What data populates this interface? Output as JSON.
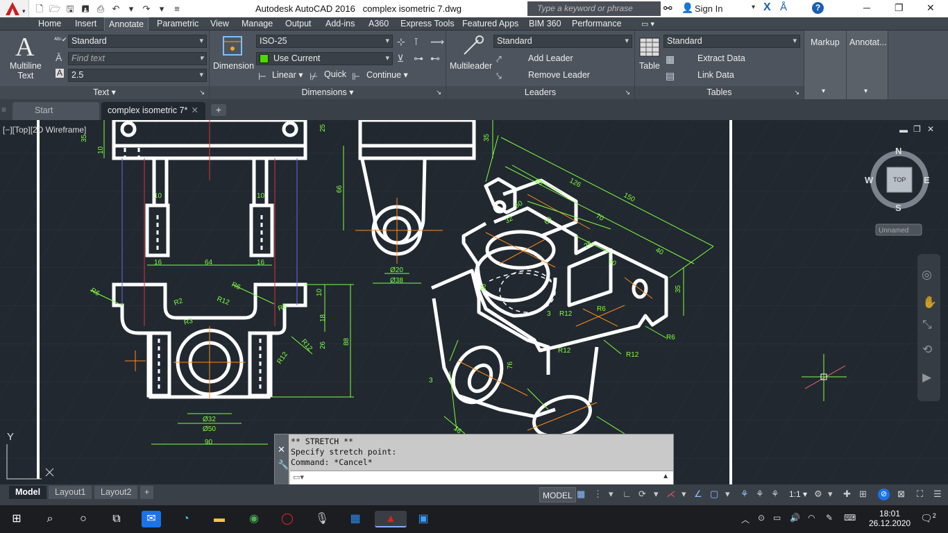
{
  "app": {
    "title": "Autodesk AutoCAD 2016",
    "filename": "complex isometric 7.dwg",
    "search_placeholder": "Type a keyword or phrase",
    "signin": "Sign In"
  },
  "ribbon_tabs": [
    "Home",
    "Insert",
    "Annotate",
    "Parametric",
    "View",
    "Manage",
    "Output",
    "Add-ins",
    "A360",
    "Express Tools",
    "Featured Apps",
    "BIM 360",
    "Performance"
  ],
  "active_tab": "Annotate",
  "text_panel": {
    "title": "Text",
    "multiline_label": "Multiline\nText",
    "style": "Standard",
    "find_placeholder": "Find text",
    "height": "2.5"
  },
  "dimensions_panel": {
    "title": "Dimensions",
    "dimension_label": "Dimension",
    "style": "ISO-25",
    "layer": "Use Current",
    "linear": "Linear",
    "quick": "Quick",
    "continue": "Continue"
  },
  "leaders_panel": {
    "title": "Leaders",
    "multileader_label": "Multileader",
    "style": "Standard",
    "add_leader": "Add Leader",
    "remove_leader": "Remove Leader"
  },
  "tables_panel": {
    "title": "Tables",
    "table_label": "Table",
    "style": "Standard",
    "extract": "Extract Data",
    "link": "Link Data"
  },
  "markup_panel": {
    "title": "Markup"
  },
  "annotat_panel": {
    "title": "Annotat..."
  },
  "doc_tabs": [
    {
      "label": "Start"
    },
    {
      "label": "complex isometric 7*"
    }
  ],
  "viewport_label": "[−][Top][2D Wireframe]",
  "viewcube": {
    "n": "N",
    "s": "S",
    "e": "E",
    "w": "W",
    "top": "TOP",
    "ucs": "Unnamed"
  },
  "ucs": {
    "x": "X",
    "y": "Y"
  },
  "dims": {
    "d35": "35",
    "d10a": "10",
    "d25": "25",
    "d10b": "10",
    "d10c": "10",
    "d16a": "16",
    "d64": "64",
    "d16b": "16",
    "r6a": "R6",
    "r2": "R2",
    "r12a": "R12",
    "r6b": "R6",
    "r6c": "R6",
    "r3": "R3",
    "r12b": "R12",
    "d10d": "10",
    "d18": "18",
    "d26": "26",
    "d88": "88",
    "d32": "Ø32",
    "d50": "Ø50",
    "d90": "90",
    "d66": "66",
    "d20": "Ø20",
    "d38": "Ø38",
    "d35b": "35",
    "i40a": "40",
    "i126": "126",
    "i150": "150",
    "i50": "50",
    "i32": "32",
    "i60": "60",
    "i70": "70",
    "i25": "25",
    "i40b": "40",
    "i40c": "40",
    "i35": "35",
    "i36": "36",
    "ir12a": "R12",
    "ir6a": "R6",
    "i3": "3",
    "ir12b": "R12",
    "ir12c": "R12",
    "ir6b": "R6",
    "i76": "76",
    "i16": "16",
    "i3b": "3"
  },
  "command": {
    "lines": "** STRETCH **\nSpecify stretch point:\nCommand: *Cancel*"
  },
  "layout_tabs": [
    "Model",
    "Layout1",
    "Layout2"
  ],
  "status": {
    "model": "MODEL",
    "scale": "1:1"
  },
  "clock": {
    "time": "18:01",
    "date": "26.12.2020",
    "notif": "2"
  },
  "colors": {
    "accent": "#cc1f1f",
    "dimension": "#7fff3f",
    "center": "#ff8c1a",
    "geometry": "#ffffff",
    "canvas": "#212830"
  }
}
